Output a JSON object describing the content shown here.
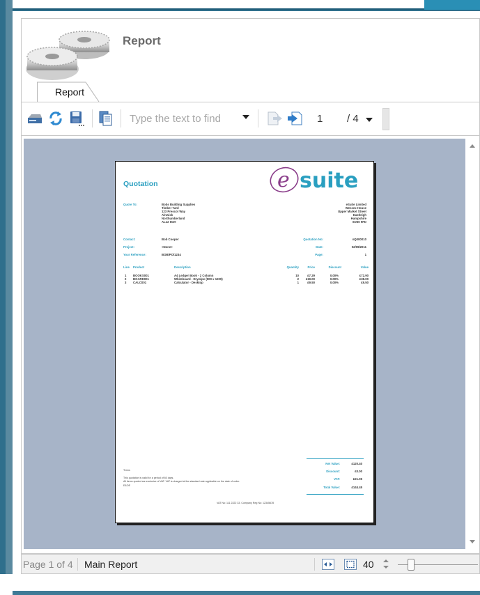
{
  "window": {
    "title": "Report"
  },
  "tabs": [
    {
      "label": "Report"
    }
  ],
  "toolbar": {
    "find_placeholder": "Type the text to find",
    "current_page": "1",
    "total_pages": "/ 4"
  },
  "icons": {
    "print": "printer-icon",
    "refresh": "refresh-icon",
    "save": "save-icon",
    "copy": "copy-icon",
    "prev": "previous-result-icon",
    "next": "next-result-icon"
  },
  "document": {
    "title": "Quotation",
    "logo_text": "esuite",
    "quote_to_label": "Quote To:",
    "quote_to_lines": [
      "Bobs Building Supplies",
      "Timber Yard",
      "123 Prescot Way",
      "Alnwick",
      "Northumberland",
      "AL12 6GH"
    ],
    "supplier_lines": [
      "eSuite Limited",
      "Wessex House",
      "Upper Market Street",
      "Eastleigh",
      "Hampshire",
      "SO50 9FD"
    ],
    "contact_label": "Contact:",
    "contact_value": "Bob Cooper",
    "project_label": "Project:",
    "project_value": "<None>",
    "reference_label": "Your Reference:",
    "reference_value": "BOB/PO/1234",
    "quote_no_label": "Quotation No:",
    "quote_no_value": "nQ000010",
    "date_label": "Date:",
    "date_value": "02/09/2011",
    "page_label": "Page:",
    "page_value": "1",
    "columns": [
      "Line",
      "Product",
      "Description",
      "Quantity",
      "Price",
      "Discount",
      "Value"
    ],
    "lines": [
      {
        "line": "1",
        "product": "BOOKS001",
        "description": "A4 Ledger Book - 2 Column",
        "quantity": "10",
        "price": "£7.29",
        "discount": "0.00%",
        "value": "£72.90"
      },
      {
        "line": "2",
        "product": "BOARD001",
        "description": "Whiteboard - Drywipe (900 x 1200)",
        "quantity": "2",
        "price": "£19.00",
        "discount": "0.00%",
        "value": "£38.00"
      },
      {
        "line": "3",
        "product": "CALC001",
        "description": "Calculator - Desktop",
        "quantity": "1",
        "price": "£9.50",
        "discount": "0.00%",
        "value": "£9.50"
      }
    ],
    "terms_heading": "Terms",
    "terms_lines": [
      "This quotation is valid for a period of 60 days.",
      "All items quoted are exclusive of VAT.  VAT is charged at the standard rate applicable on the date of order.",
      "E&OE"
    ],
    "net_label": "Net Value:",
    "net_value": "£120.40",
    "discount_label": "Discount:",
    "discount_value": "£0.00",
    "vat_label": "VAT:",
    "vat_value": "£21.05",
    "total_label": "Total Value:",
    "total_value": "£144.45",
    "footer": "VAT No: 111 2222 33. Company Reg No: 12345678"
  },
  "status": {
    "page_info": "Page 1 of 4",
    "report_name": "Main Report",
    "zoom": "40"
  },
  "colors": {
    "accent": "#2a9fc0",
    "canvas": "#a7b4c8",
    "logo_purple": "#8a3d8a"
  }
}
